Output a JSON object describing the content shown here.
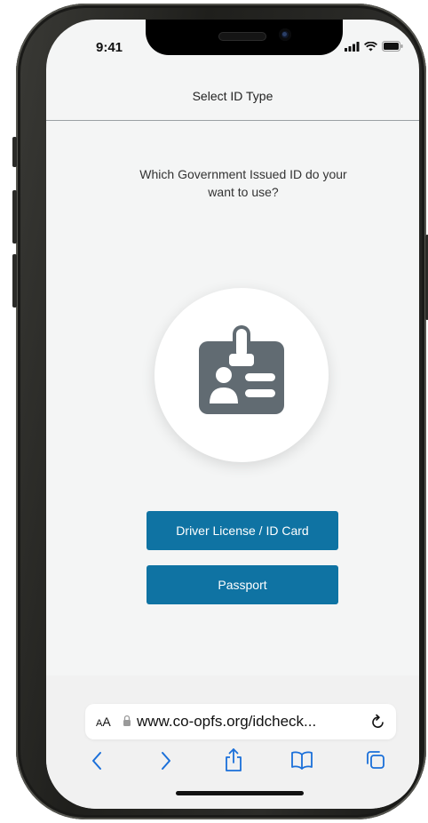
{
  "status_bar": {
    "time": "9:41"
  },
  "header": {
    "title": "Select ID Type"
  },
  "main": {
    "question": "Which Government Issued ID do your want to use?",
    "buttons": [
      {
        "label": "Driver License / ID Card"
      },
      {
        "label": "Passport"
      }
    ]
  },
  "browser": {
    "text_size_label_small": "A",
    "text_size_label_large": "A",
    "url": "www.co-opfs.org/idcheck..."
  },
  "colors": {
    "primary_button": "#0f73a3",
    "icon_gray": "#616b72",
    "background": "#f4f5f5"
  },
  "icons": [
    "id-card-icon",
    "lock-icon",
    "reload-icon",
    "back-icon",
    "forward-icon",
    "share-icon",
    "bookmarks-icon",
    "tabs-icon",
    "signal-icon",
    "wifi-icon",
    "battery-icon"
  ]
}
